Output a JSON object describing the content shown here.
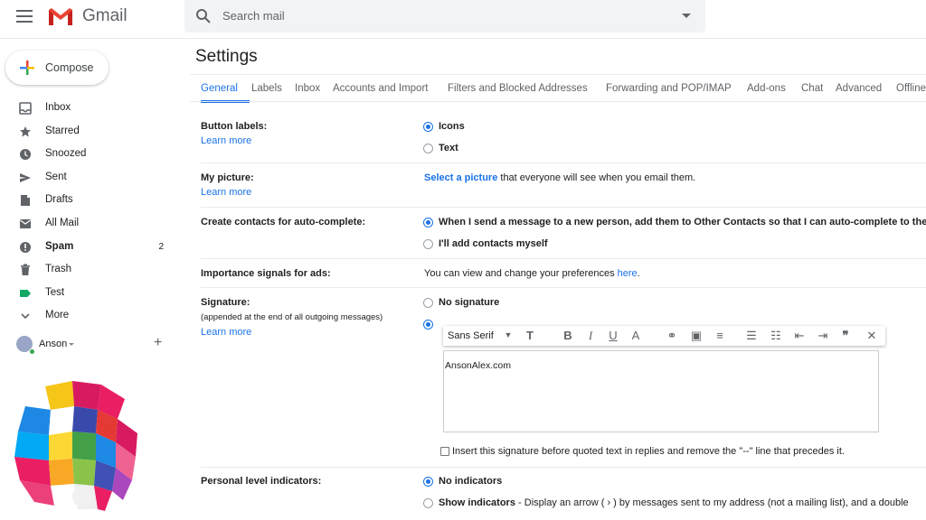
{
  "app": {
    "name": "Gmail"
  },
  "search": {
    "placeholder": "Search mail"
  },
  "compose": {
    "label": "Compose"
  },
  "nav": {
    "items": [
      {
        "label": "Inbox",
        "icon": "inbox-icon",
        "count": ""
      },
      {
        "label": "Starred",
        "icon": "star-icon",
        "count": ""
      },
      {
        "label": "Snoozed",
        "icon": "clock-icon",
        "count": ""
      },
      {
        "label": "Sent",
        "icon": "send-icon",
        "count": ""
      },
      {
        "label": "Drafts",
        "icon": "draft-icon",
        "count": ""
      },
      {
        "label": "All Mail",
        "icon": "mail-icon",
        "count": ""
      },
      {
        "label": "Spam",
        "icon": "spam-icon",
        "count": "2"
      },
      {
        "label": "Trash",
        "icon": "trash-icon",
        "count": ""
      },
      {
        "label": "Test",
        "icon": "label-icon",
        "count": ""
      },
      {
        "label": "More",
        "icon": "chevron-down-icon",
        "count": ""
      }
    ]
  },
  "user": {
    "name": "Anson"
  },
  "page": {
    "title": "Settings"
  },
  "tabs": [
    "General",
    "Labels",
    "Inbox",
    "Accounts and Import",
    "Filters and Blocked Addresses",
    "Forwarding and POP/IMAP",
    "Add-ons",
    "Chat",
    "Advanced",
    "Offline"
  ],
  "settings": {
    "button_labels": {
      "title": "Button labels:",
      "link": "Learn more",
      "options": [
        "Icons",
        "Text"
      ]
    },
    "my_picture": {
      "title": "My picture:",
      "link": "Learn more",
      "action": "Select a picture",
      "text": " that everyone will see when you email them."
    },
    "contacts": {
      "title": "Create contacts for auto-complete:",
      "options": [
        "When I send a message to a new person, add them to Other Contacts so that I can auto-complete to them",
        "I'll add contacts myself"
      ]
    },
    "importance": {
      "title": "Importance signals for ads:",
      "text": "You can view and change your preferences ",
      "link": "here",
      "suffix": "."
    },
    "signature": {
      "title": "Signature:",
      "subtitle": "(appended at the end of all outgoing messages)",
      "link": "Learn more",
      "option_none": "No signature",
      "font": "Sans Serif",
      "content": "AnsonAlex.com",
      "checkbox": "Insert this signature before quoted text in replies and remove the \"--\" line that precedes it."
    },
    "personal_level": {
      "title": "Personal level indicators:",
      "option_none": "No indicators",
      "option_show": "Show indicators",
      "option_show_desc": " - Display an arrow ( › ) by messages sent to my address (not a mailing list), and a double"
    }
  },
  "colors": {
    "accent": "#1a73e8",
    "gmail_red": "#ea4335"
  }
}
